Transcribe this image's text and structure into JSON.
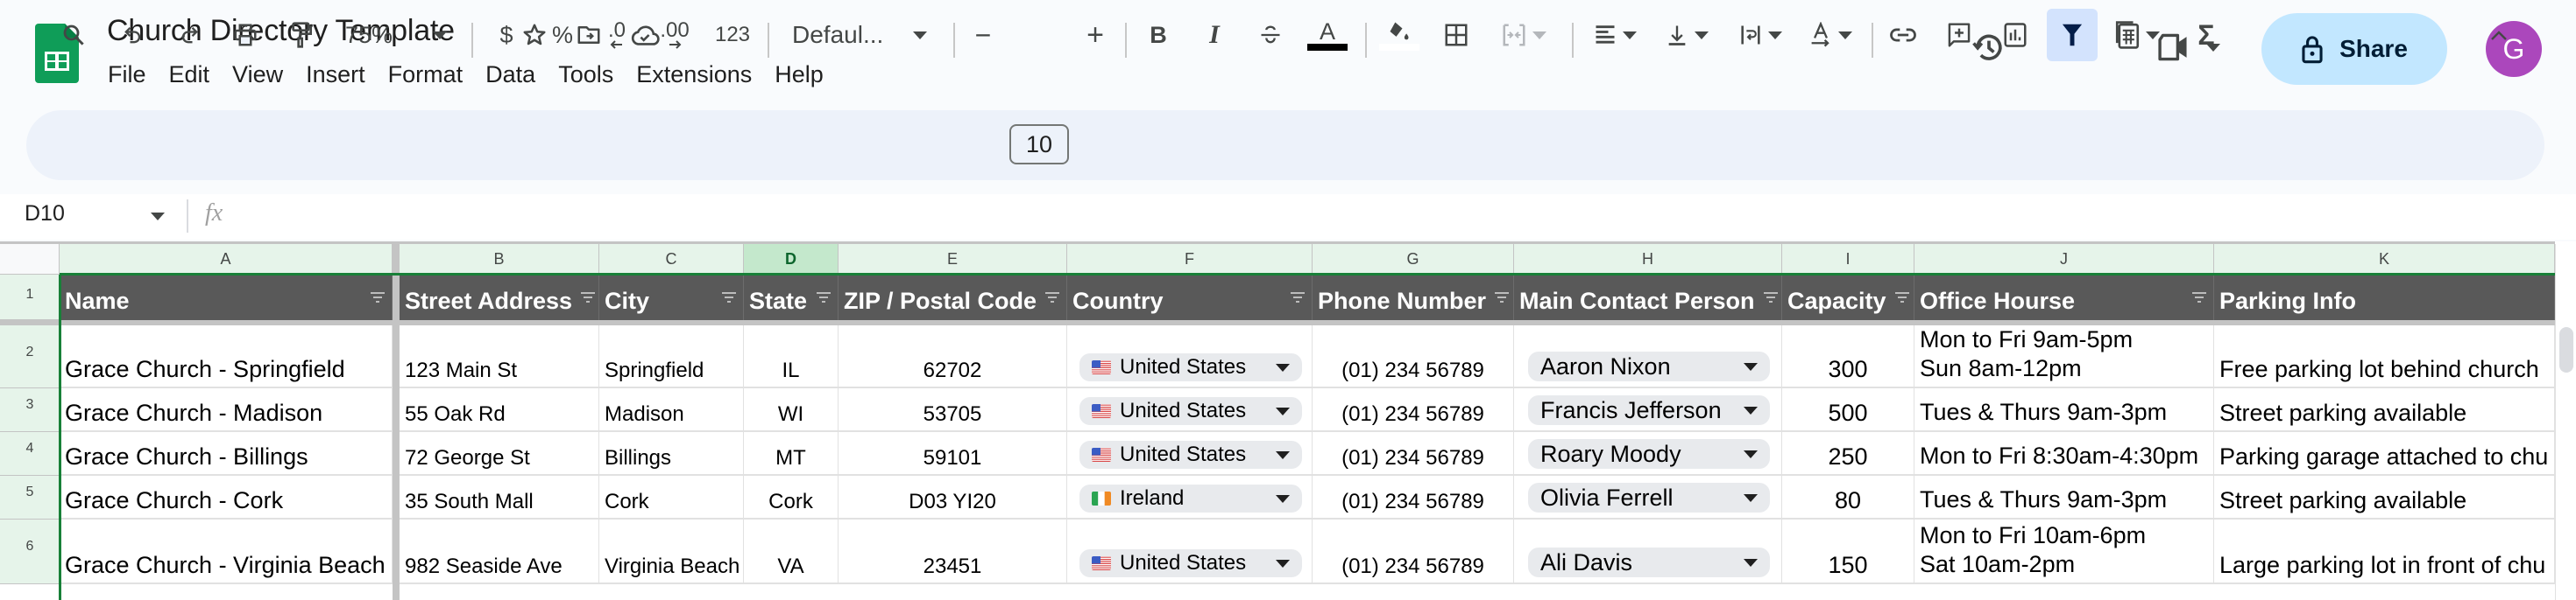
{
  "app": {
    "title": "Church Directory Template",
    "menu": [
      "File",
      "Edit",
      "View",
      "Insert",
      "Format",
      "Data",
      "Tools",
      "Extensions",
      "Help"
    ],
    "share_label": "Share",
    "avatar_initial": "G",
    "accent_color": "#0f9d58"
  },
  "toolbar": {
    "zoom": "75%",
    "currency": "$",
    "percent": "%",
    "decrease_decimal": ".0",
    "increase_decimal": ".00",
    "number_format": "123",
    "font": "Defaul...",
    "font_size": "10",
    "decrease_size": "−",
    "increase_size": "+",
    "bold": "B",
    "italic": "I",
    "sigma": "Σ"
  },
  "formula_bar": {
    "cell_ref": "D10",
    "fx": "fx",
    "value": ""
  },
  "sheet": {
    "column_letters": [
      "A",
      "B",
      "C",
      "D",
      "E",
      "F",
      "G",
      "H",
      "I",
      "J",
      "K"
    ],
    "selected_column": "D",
    "row_numbers": [
      "1",
      "2",
      "3",
      "4",
      "5",
      "6"
    ],
    "headers": [
      "Name",
      "Street Address",
      "City",
      "State",
      "ZIP / Postal Code",
      "Country",
      "Phone Number",
      "Main Contact Person",
      "Capacity",
      "Office Hourse",
      "Parking Info"
    ],
    "rows": [
      {
        "name": "Grace Church - Springfield",
        "street": "123 Main St",
        "city": "Springfield",
        "state": "IL",
        "zip": "62702",
        "country": "United States",
        "country_flag": "us",
        "phone": "(01) 234 56789",
        "contact": "Aaron Nixon",
        "capacity": "300",
        "hours": [
          "Mon to Fri 9am-5pm",
          "Sun 8am-12pm"
        ],
        "parking": "Free parking lot behind church"
      },
      {
        "name": "Grace Church - Madison",
        "street": "55 Oak Rd",
        "city": "Madison",
        "state": "WI",
        "zip": "53705",
        "country": "United States",
        "country_flag": "us",
        "phone": "(01) 234 56789",
        "contact": "Francis Jefferson",
        "capacity": "500",
        "hours": [
          "Tues & Thurs 9am-3pm"
        ],
        "parking": "Street parking available"
      },
      {
        "name": "Grace Church - Billings",
        "street": "72 George St",
        "city": "Billings",
        "state": "MT",
        "zip": "59101",
        "country": "United States",
        "country_flag": "us",
        "phone": "(01) 234 56789",
        "contact": "Roary Moody",
        "capacity": "250",
        "hours": [
          "Mon to Fri 8:30am-4:30pm"
        ],
        "parking": "Parking garage attached to chu"
      },
      {
        "name": "Grace Church - Cork",
        "street": "35 South Mall",
        "city": "Cork",
        "state": "Cork",
        "zip": "D03 YI20",
        "country": "Ireland",
        "country_flag": "ie",
        "phone": "(01) 234 56789",
        "contact": "Olivia Ferrell",
        "capacity": "80",
        "hours": [
          "Tues & Thurs 9am-3pm"
        ],
        "parking": "Street parking available"
      },
      {
        "name": "Grace Church - Virginia Beach",
        "street": "982 Seaside Ave",
        "city": "Virginia Beach",
        "state": "VA",
        "zip": "23451",
        "country": "United States",
        "country_flag": "us",
        "phone": "(01) 234 56789",
        "contact": "Ali Davis",
        "capacity": "150",
        "hours": [
          "Mon to Fri 10am-6pm",
          "Sat 10am-2pm"
        ],
        "parking": "Large parking lot in front of chu"
      }
    ]
  }
}
